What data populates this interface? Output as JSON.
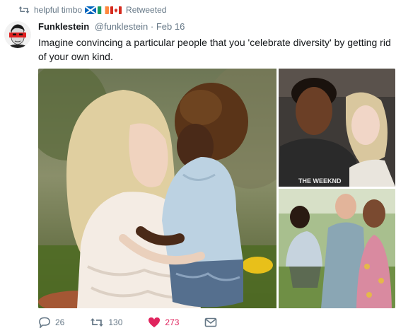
{
  "retweet": {
    "user": "helpful timbo",
    "label": "Retweeted",
    "icon": "retweet-icon",
    "flags": [
      "scotland-flag",
      "ireland-flag",
      "canada-flag"
    ]
  },
  "tweet": {
    "display_name": "Funklestein",
    "handle": "@funklestein",
    "separator": "·",
    "date": "Feb 16",
    "text": "Imagine convincing a particular people that you 'celebrate diversity' by getting rid of your own kind."
  },
  "media": {
    "photos": [
      "main-photo",
      "top-right-photo",
      "bottom-right-photo"
    ],
    "shirt_text": "THE WEEKND"
  },
  "actions": {
    "reply_count": "26",
    "retweet_count": "130",
    "like_count": "273",
    "like_color": "#e0245e",
    "muted_color": "#657786"
  }
}
